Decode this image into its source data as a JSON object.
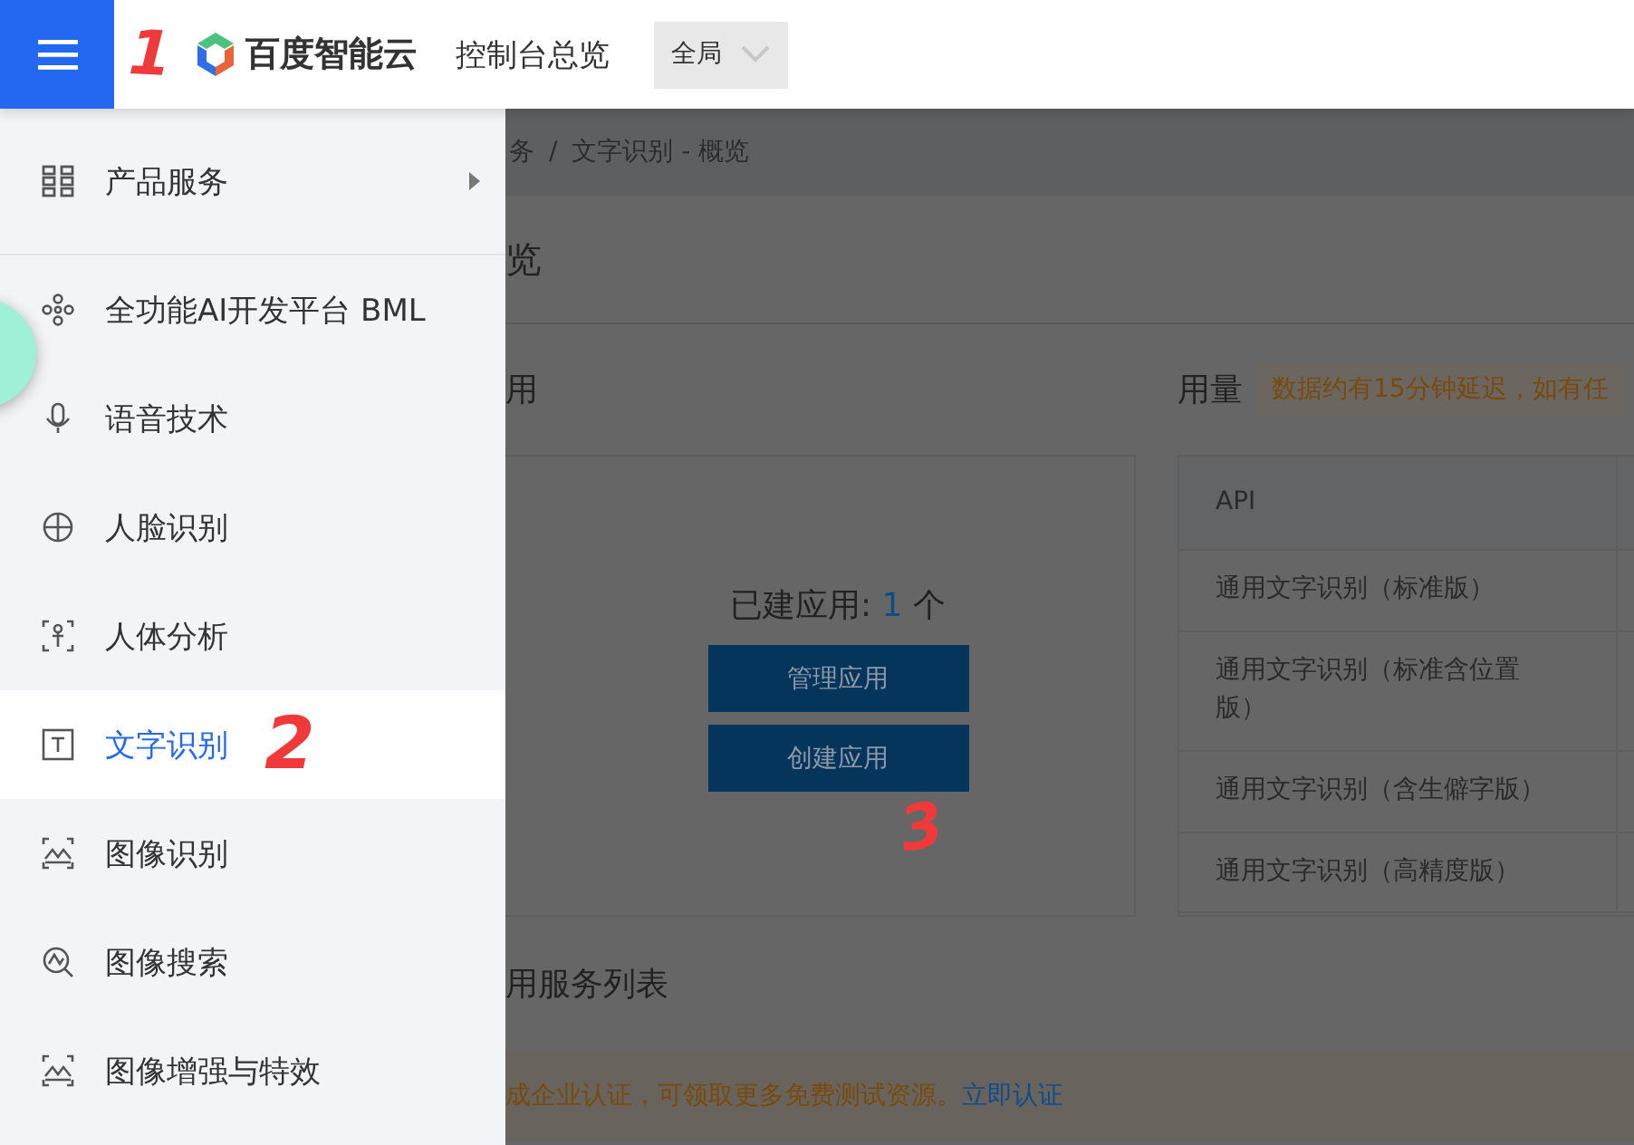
{
  "topbar": {
    "logo_text": "百度智能云",
    "nav_link": "控制台总览",
    "region_select": "全局"
  },
  "sidebar": {
    "header": {
      "label": "产品服务"
    },
    "items": [
      {
        "label": "全功能AI开发平台 BML",
        "kind": "nodes",
        "selected": false
      },
      {
        "label": "语音技术",
        "kind": "mic",
        "selected": false
      },
      {
        "label": "人脸识别",
        "kind": "globe",
        "selected": false
      },
      {
        "label": "人体分析",
        "kind": "body",
        "selected": false
      },
      {
        "label": "文字识别",
        "kind": "text",
        "selected": true
      },
      {
        "label": "图像识别",
        "kind": "image",
        "selected": false
      },
      {
        "label": "图像搜索",
        "kind": "search",
        "selected": false
      },
      {
        "label": "图像增强与特效",
        "kind": "image",
        "selected": false
      }
    ]
  },
  "breadcrumb": {
    "parent": "务",
    "separator": "/",
    "current": "文字识别 - 概览"
  },
  "page_title": "览",
  "apps_section": {
    "title": "用",
    "count_label": "已建应用:",
    "count": "1",
    "count_unit": "个",
    "buttons": [
      "管理应用",
      "创建应用"
    ]
  },
  "usage_section": {
    "title": "用量",
    "note": "数据约有15分钟延迟，如有任"
  },
  "usage_table": {
    "columns": [
      "API"
    ],
    "rows": [
      "通用文字识别（标准版）",
      "通用文字识别（标准含位置版）",
      "通用文字识别（含生僻字版）",
      "通用文字识别（高精度版）"
    ]
  },
  "service_list_title": "用服务列表",
  "notice": {
    "text": "成企业认证，可领取更多免费测试资源。",
    "link": "立即认证"
  },
  "annotations": [
    "1",
    "2",
    "3"
  ]
}
